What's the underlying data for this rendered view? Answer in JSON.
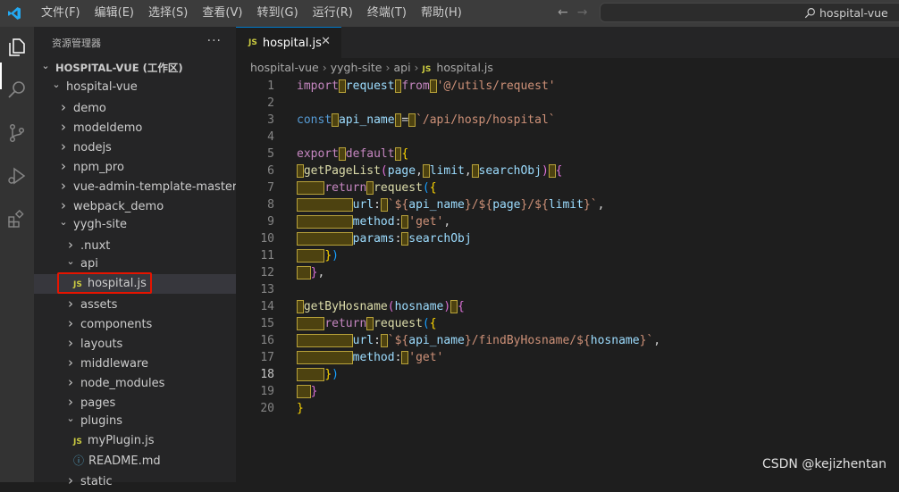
{
  "titlebar": {
    "menu": [
      "文件(F)",
      "编辑(E)",
      "选择(S)",
      "查看(V)",
      "转到(G)",
      "运行(R)",
      "终端(T)",
      "帮助(H)"
    ],
    "search_text": "hospital-vue"
  },
  "sidebar": {
    "header": "资源管理器",
    "tree": [
      {
        "label": "HOSPITAL-VUE (工作区)",
        "depth": 0,
        "chev": "v",
        "bold": true
      },
      {
        "label": "hospital-vue",
        "depth": 1,
        "chev": "v"
      },
      {
        "label": "demo",
        "depth": 2,
        "chev": ">"
      },
      {
        "label": "modeldemo",
        "depth": 2,
        "chev": ">"
      },
      {
        "label": "nodejs",
        "depth": 2,
        "chev": ">"
      },
      {
        "label": "npm_pro",
        "depth": 2,
        "chev": ">"
      },
      {
        "label": "vue-admin-template-master",
        "depth": 2,
        "chev": ">"
      },
      {
        "label": "webpack_demo",
        "depth": 2,
        "chev": ">"
      },
      {
        "label": "yygh-site",
        "depth": 2,
        "chev": "v"
      },
      {
        "label": ".nuxt",
        "depth": 3,
        "chev": ">"
      },
      {
        "label": "api",
        "depth": 3,
        "chev": "v"
      },
      {
        "label": "hospital.js",
        "depth": 3,
        "icon": "JS",
        "selected": true
      },
      {
        "label": "assets",
        "depth": 3,
        "chev": ">"
      },
      {
        "label": "components",
        "depth": 3,
        "chev": ">"
      },
      {
        "label": "layouts",
        "depth": 3,
        "chev": ">"
      },
      {
        "label": "middleware",
        "depth": 3,
        "chev": ">"
      },
      {
        "label": "node_modules",
        "depth": 3,
        "chev": ">"
      },
      {
        "label": "pages",
        "depth": 3,
        "chev": ">"
      },
      {
        "label": "plugins",
        "depth": 3,
        "chev": "v"
      },
      {
        "label": "myPlugin.js",
        "depth": 3,
        "icon": "JS"
      },
      {
        "label": "README.md",
        "depth": 3,
        "icon": "info"
      },
      {
        "label": "static",
        "depth": 3,
        "chev": ">"
      }
    ]
  },
  "editor": {
    "tab_label": "hospital.js",
    "breadcrumb": [
      "hospital-vue",
      "yygh-site",
      "api",
      "hospital.js"
    ],
    "current_line": 18,
    "code": [
      [
        [
          "kw",
          "import"
        ],
        [
          "ws",
          " "
        ],
        [
          "var",
          "request"
        ],
        [
          "ws",
          " "
        ],
        [
          "kw",
          "from"
        ],
        [
          "ws",
          " "
        ],
        [
          "str",
          "'@/utils/request'"
        ]
      ],
      [],
      [
        [
          "kw2",
          "const"
        ],
        [
          "ws",
          " "
        ],
        [
          "var",
          "api_name"
        ],
        [
          "ws",
          " "
        ],
        [
          "pun",
          "="
        ],
        [
          "ws",
          " "
        ],
        [
          "str",
          "`/api/hosp/hospital`"
        ]
      ],
      [],
      [
        [
          "kw",
          "export"
        ],
        [
          "ws",
          " "
        ],
        [
          "kw",
          "default"
        ],
        [
          "ws",
          " "
        ],
        [
          "br1",
          "{"
        ]
      ],
      [
        [
          "ws",
          " "
        ],
        [
          "fn",
          "getPageList"
        ],
        [
          "br2",
          "("
        ],
        [
          "var",
          "page"
        ],
        [
          "pun",
          ","
        ],
        [
          "ws",
          " "
        ],
        [
          "var",
          "limit"
        ],
        [
          "pun",
          ","
        ],
        [
          "ws",
          " "
        ],
        [
          "var",
          "searchObj"
        ],
        [
          "br2",
          ")"
        ],
        [
          "ws",
          " "
        ],
        [
          "br2",
          "{"
        ]
      ],
      [
        [
          "ws",
          "    "
        ],
        [
          "kw",
          "return"
        ],
        [
          "ws",
          " "
        ],
        [
          "fn",
          "request"
        ],
        [
          "br3",
          "("
        ],
        [
          "br1",
          "{"
        ]
      ],
      [
        [
          "ws",
          "        "
        ],
        [
          "var",
          "url"
        ],
        [
          "pun",
          ":"
        ],
        [
          "ws",
          " "
        ],
        [
          "str",
          "`${"
        ],
        [
          "var",
          "api_name"
        ],
        [
          "str",
          "}/${"
        ],
        [
          "var",
          "page"
        ],
        [
          "str",
          "}/${"
        ],
        [
          "var",
          "limit"
        ],
        [
          "str",
          "}`"
        ],
        [
          "pun",
          ","
        ]
      ],
      [
        [
          "ws",
          "        "
        ],
        [
          "var",
          "method"
        ],
        [
          "pun",
          ":"
        ],
        [
          "ws",
          " "
        ],
        [
          "str",
          "'get'"
        ],
        [
          "pun",
          ","
        ]
      ],
      [
        [
          "ws",
          "        "
        ],
        [
          "var",
          "params"
        ],
        [
          "pun",
          ":"
        ],
        [
          "ws",
          " "
        ],
        [
          "var",
          "searchObj"
        ]
      ],
      [
        [
          "ws",
          "    "
        ],
        [
          "br1",
          "}"
        ],
        [
          "br3",
          ")"
        ]
      ],
      [
        [
          "ws",
          "  "
        ],
        [
          "br2",
          "}"
        ],
        [
          "pun",
          ","
        ]
      ],
      [],
      [
        [
          "ws",
          " "
        ],
        [
          "fn",
          "getByHosname"
        ],
        [
          "br2",
          "("
        ],
        [
          "var",
          "hosname"
        ],
        [
          "br2",
          ")"
        ],
        [
          "ws",
          " "
        ],
        [
          "br2",
          "{"
        ]
      ],
      [
        [
          "ws",
          "    "
        ],
        [
          "kw",
          "return"
        ],
        [
          "ws",
          " "
        ],
        [
          "fn",
          "request"
        ],
        [
          "br3",
          "("
        ],
        [
          "br1",
          "{"
        ]
      ],
      [
        [
          "ws",
          "        "
        ],
        [
          "var",
          "url"
        ],
        [
          "pun",
          ":"
        ],
        [
          "ws",
          " "
        ],
        [
          "str",
          "`${"
        ],
        [
          "var",
          "api_name"
        ],
        [
          "str",
          "}/findByHosname/${"
        ],
        [
          "var",
          "hosname"
        ],
        [
          "str",
          "}`"
        ],
        [
          "pun",
          ","
        ]
      ],
      [
        [
          "ws",
          "        "
        ],
        [
          "var",
          "method"
        ],
        [
          "pun",
          ":"
        ],
        [
          "ws",
          " "
        ],
        [
          "str",
          "'get'"
        ]
      ],
      [
        [
          "ws",
          "    "
        ],
        [
          "br1",
          "}"
        ],
        [
          "br3",
          ")"
        ]
      ],
      [
        [
          "ws",
          "  "
        ],
        [
          "br2",
          "}"
        ]
      ],
      [
        [
          "br1",
          "}"
        ]
      ]
    ]
  },
  "watermark": "CSDN @kejizhentan",
  "colors": {
    "accent": "#007acc",
    "highlight_box": "#e51400"
  }
}
